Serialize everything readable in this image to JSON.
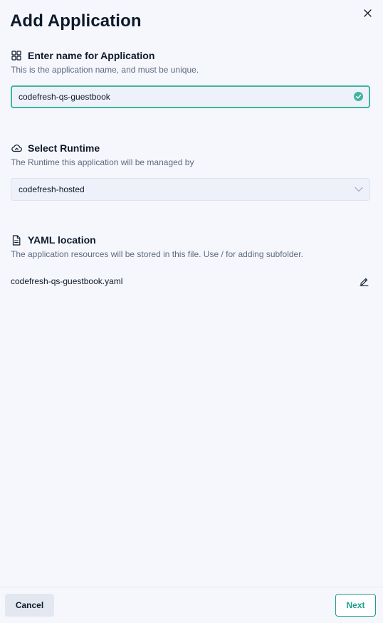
{
  "dialog": {
    "title": "Add Application"
  },
  "name_section": {
    "icon": "grid-icon",
    "title": "Enter name for Application",
    "description": "This is the application name, and must be unique.",
    "value": "codefresh-qs-guestbook",
    "valid_icon": "check-circle-icon"
  },
  "runtime_section": {
    "icon": "cloud-icon",
    "title": "Select Runtime",
    "description": "The Runtime this application will be managed by",
    "selected": "codefresh-hosted"
  },
  "yaml_section": {
    "icon": "file-icon",
    "title": "YAML location",
    "description": "The application resources will be stored in this file. Use / for adding subfolder.",
    "filename": "codefresh-qs-guestbook.yaml"
  },
  "footer": {
    "cancel_label": "Cancel",
    "next_label": "Next"
  },
  "colors": {
    "accent": "#1f9e8c",
    "valid": "#3fb59e",
    "background": "#f6f7fc",
    "text": "#0e1a2b",
    "muted": "#5b6b80"
  }
}
